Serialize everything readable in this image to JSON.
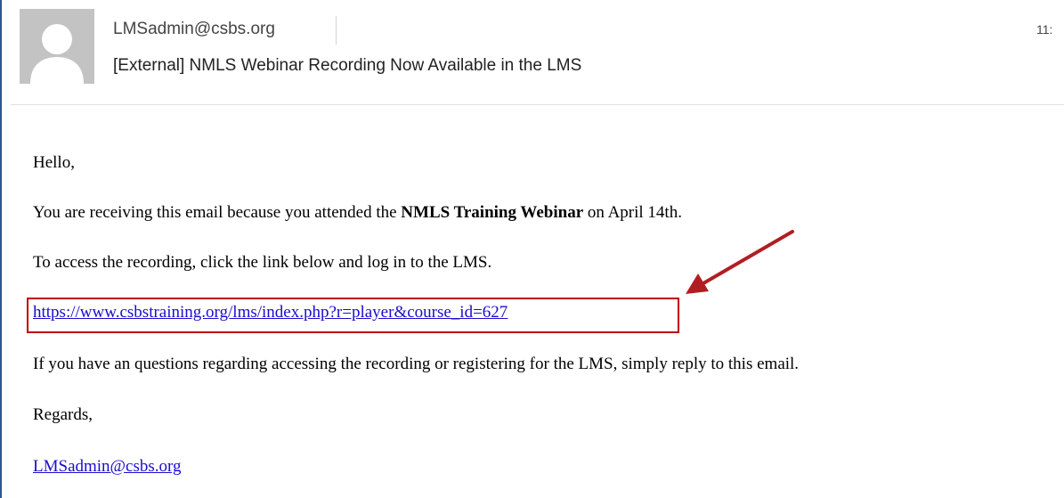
{
  "header": {
    "sender": "LMSadmin@csbs.org",
    "time": "11:",
    "subject": "[External] NMLS Webinar Recording Now Available in the LMS"
  },
  "body": {
    "greeting": "Hello,",
    "receiving_pre": "You are receiving this email because you attended the",
    "receiving_bold": "NMLS Training Webinar",
    "receiving_post": "on April 14th.",
    "access": "To access the recording, click the link below and log in to the LMS.",
    "link": "https://www.csbstraining.org/lms/index.php?r=player&course_id=627",
    "questions": "If you have an questions regarding accessing the recording or registering for the LMS, simply reply to this email.",
    "regards": "Regards,",
    "signature_email": "LMSadmin@csbs.org"
  },
  "colors": {
    "link": "#1a0dcc",
    "highlight": "#c00000",
    "arrow": "#b01e23"
  },
  "icons": {
    "avatar": "default-person-icon",
    "annotation": "red-arrow-icon"
  }
}
